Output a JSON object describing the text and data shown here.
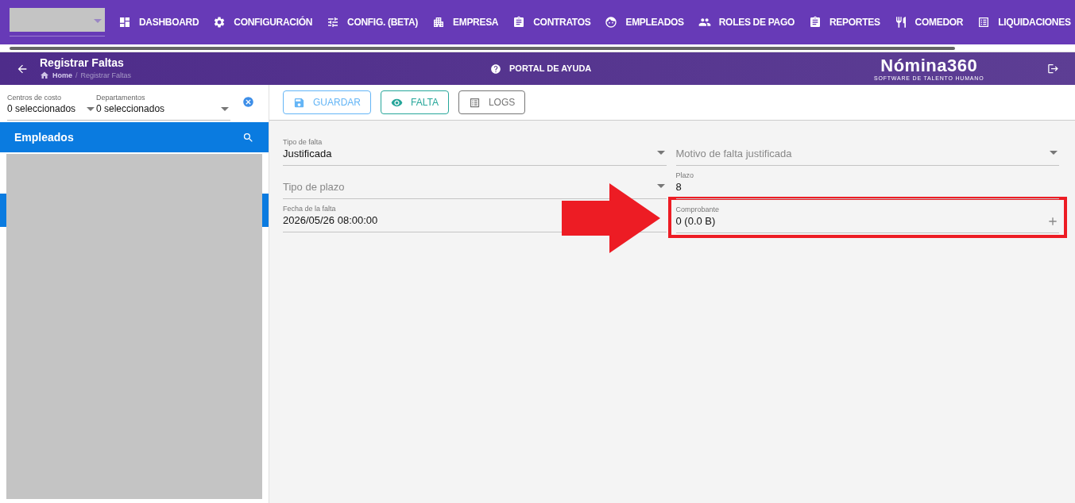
{
  "nav": {
    "items": [
      {
        "label": "DASHBOARD",
        "kind": "dashboard"
      },
      {
        "label": "CONFIGURACIÓN",
        "kind": "gear"
      },
      {
        "label": "CONFIG. (BETA)",
        "kind": "sliders"
      },
      {
        "label": "EMPRESA",
        "kind": "building"
      },
      {
        "label": "CONTRATOS",
        "kind": "clipboard"
      },
      {
        "label": "EMPLEADOS",
        "kind": "face"
      },
      {
        "label": "ROLES DE PAGO",
        "kind": "people"
      },
      {
        "label": "REPORTES",
        "kind": "clipboard"
      },
      {
        "label": "COMEDOR",
        "kind": "cutlery"
      },
      {
        "label": "LIQUIDACIONES",
        "kind": "list"
      }
    ]
  },
  "header": {
    "title": "Registrar Faltas",
    "breadcrumb": [
      {
        "label": "Home",
        "current": false
      },
      {
        "label": "Registrar Faltas",
        "current": true
      }
    ],
    "breadcrumb_separator": "/",
    "help": "PORTAL DE AYUDA",
    "logo": "Nómina360",
    "logo_tagline": "SOFTWARE DE TALENTO HUMANO"
  },
  "filters": [
    {
      "label": "Centros de costo",
      "value": "0 seleccionados"
    },
    {
      "label": "Departamentos",
      "value": "0 seleccionados"
    }
  ],
  "employees": {
    "title": "Empleados"
  },
  "toolbar": [
    {
      "label": "GUARDAR",
      "kind": "save",
      "color": "#64b5f6"
    },
    {
      "label": "FALTA",
      "kind": "eye",
      "color": "#26a69a"
    },
    {
      "label": "LOGS",
      "kind": "list",
      "color": "#757575"
    }
  ],
  "form_rows": [
    {
      "fields": [
        {
          "label": "Tipo de falta",
          "value": "Justificada",
          "kind": "select",
          "highlighted": false
        },
        {
          "label": "Motivo de falta justificada",
          "kind": "select",
          "highlighted": false
        }
      ]
    },
    {
      "fields": [
        {
          "label": "Tipo de plazo",
          "kind": "select",
          "highlighted": false
        },
        {
          "label": "Plazo",
          "value": "8",
          "kind": "text",
          "highlighted": false
        }
      ]
    },
    {
      "fields": [
        {
          "label": "Fecha de la falta",
          "value": "2026/05/26 08:00:00",
          "kind": "text",
          "highlighted": false
        },
        {
          "label": "Comprobante",
          "value": "0 (0.0 B)",
          "kind": "file",
          "highlighted": true
        }
      ]
    }
  ]
}
